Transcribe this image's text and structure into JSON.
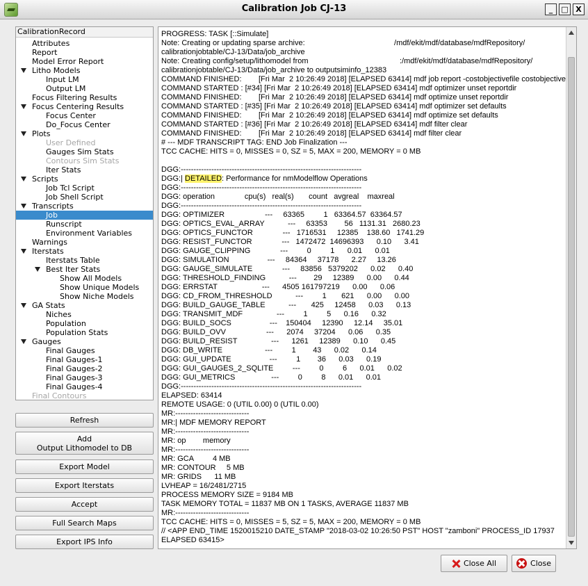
{
  "window": {
    "title": "Calibration Job CJ-13",
    "minimize": "_",
    "maximize": "□",
    "close": "X"
  },
  "tree": {
    "header": "CalibrationRecord",
    "nodes": [
      {
        "label": "Attributes",
        "indent": 1,
        "state": "leaf"
      },
      {
        "label": "Report",
        "indent": 1,
        "state": "leaf"
      },
      {
        "label": "Model Error Report",
        "indent": 1,
        "state": "leaf"
      },
      {
        "label": "Litho Models",
        "indent": 1,
        "state": "expanded"
      },
      {
        "label": "Input LM",
        "indent": 2,
        "state": "leaf"
      },
      {
        "label": "Output LM",
        "indent": 2,
        "state": "leaf"
      },
      {
        "label": "Focus Filtering Results",
        "indent": 1,
        "state": "leaf"
      },
      {
        "label": "Focus Centering Results",
        "indent": 1,
        "state": "expanded"
      },
      {
        "label": "Focus Center",
        "indent": 2,
        "state": "leaf"
      },
      {
        "label": "Do_Focus Center",
        "indent": 2,
        "state": "leaf"
      },
      {
        "label": "Plots",
        "indent": 1,
        "state": "expanded"
      },
      {
        "label": "User Defined",
        "indent": 2,
        "state": "leaf",
        "disabled": true
      },
      {
        "label": "Gauges Sim Stats",
        "indent": 2,
        "state": "leaf"
      },
      {
        "label": "Contours Sim Stats",
        "indent": 2,
        "state": "leaf",
        "disabled": true
      },
      {
        "label": "Iter Stats",
        "indent": 2,
        "state": "leaf"
      },
      {
        "label": "Scripts",
        "indent": 1,
        "state": "expanded"
      },
      {
        "label": "Job Tcl Script",
        "indent": 2,
        "state": "leaf"
      },
      {
        "label": "Job Shell Script",
        "indent": 2,
        "state": "leaf"
      },
      {
        "label": "Transcripts",
        "indent": 1,
        "state": "expanded"
      },
      {
        "label": "Job",
        "indent": 2,
        "state": "leaf",
        "selected": true
      },
      {
        "label": "Runscript",
        "indent": 2,
        "state": "leaf"
      },
      {
        "label": "Environment Variables",
        "indent": 2,
        "state": "leaf"
      },
      {
        "label": "Warnings",
        "indent": 1,
        "state": "leaf"
      },
      {
        "label": "Iterstats",
        "indent": 1,
        "state": "expanded"
      },
      {
        "label": "Iterstats Table",
        "indent": 2,
        "state": "leaf"
      },
      {
        "label": "Best Iter Stats",
        "indent": 2,
        "state": "expanded"
      },
      {
        "label": "Show All Models",
        "indent": 3,
        "state": "leaf"
      },
      {
        "label": "Show Unique Models",
        "indent": 3,
        "state": "leaf"
      },
      {
        "label": "Show Niche Models",
        "indent": 3,
        "state": "leaf"
      },
      {
        "label": "GA Stats",
        "indent": 1,
        "state": "expanded"
      },
      {
        "label": "Niches",
        "indent": 2,
        "state": "leaf"
      },
      {
        "label": "Population",
        "indent": 2,
        "state": "leaf"
      },
      {
        "label": "Population Stats",
        "indent": 2,
        "state": "leaf"
      },
      {
        "label": "Gauges",
        "indent": 1,
        "state": "expanded"
      },
      {
        "label": "Final Gauges",
        "indent": 2,
        "state": "leaf"
      },
      {
        "label": "Final Gauges-1",
        "indent": 2,
        "state": "leaf"
      },
      {
        "label": "Final Gauges-2",
        "indent": 2,
        "state": "leaf"
      },
      {
        "label": "Final Gauges-3",
        "indent": 2,
        "state": "leaf"
      },
      {
        "label": "Final Gauges-4",
        "indent": 2,
        "state": "leaf"
      },
      {
        "label": "Final Contours",
        "indent": 1,
        "state": "leaf",
        "disabled": true
      }
    ]
  },
  "buttons": {
    "refresh": "Refresh",
    "add_line1": "Add",
    "add_line2": "Output Lithomodel to DB",
    "export_model": "Export Model",
    "export_iterstats": "Export Iterstats",
    "accept": "Accept",
    "full_search_maps": "Full Search Maps",
    "export_ips_info": "Export IPS Info",
    "close_all": "Close All",
    "close": "Close"
  },
  "log": {
    "lines": [
      "PROGRESS: TASK [::Simulate]",
      "Note: Creating or updating sparse archive:                                          /mdf/ekit/mdf/database/mdfRepository/",
      "calibrationjobtable/CJ-13/Data/job_archive",
      "Note: Creating config/setup/lithomodel from                                           :/mdf/ekit/mdf/database/mdfRepository/",
      "calibrationjobtable/CJ-13/Data/job_archive to outputsiminfo_12383",
      "COMMAND FINISHED:        [Fri Mar  2 10:26:49 2018] [ELAPSED 63414] mdf job report -costobjectivefile costobjective",
      "COMMAND STARTED : [#34] [Fri Mar  2 10:26:49 2018] [ELAPSED 63414] mdf optimizer unset reportdir",
      "COMMAND FINISHED:        [Fri Mar  2 10:26:49 2018] [ELAPSED 63414] mdf optimize unset reportdir",
      "COMMAND STARTED : [#35] [Fri Mar  2 10:26:49 2018] [ELAPSED 63414] mdf optimizer set defaults",
      "COMMAND FINISHED:        [Fri Mar  2 10:26:49 2018] [ELAPSED 63414] mdf optimize set defaults",
      "COMMAND STARTED : [#36] [Fri Mar  2 10:26:49 2018] [ELAPSED 63414] mdf filter clear",
      "COMMAND FINISHED:        [Fri Mar  2 10:26:49 2018] [ELAPSED 63414] mdf filter clear",
      "# --- MDF TRANSCRIPT TAG: END Job Finalization ---",
      "TCC CACHE: HITS = 0, MISSES = 0, SZ = 5, MAX = 200, MEMORY = 0 MB",
      "",
      "DGG:-----------------------------------------------------------------------",
      "DGG:| DETAILED: Performance for nmModelflow Operations",
      "DGG:-----------------------------------------------------------------------",
      "DGG: operation              cpu(s)   real(s)       count   avgreal    maxreal",
      "DGG:-----------------------------------------------------------------------",
      "DGG: OPTIMIZER                   ---     63365         1   63364.57  63364.57",
      "DGG: OPTICS_EVAL_ARRAY           ---     63353        56   1131.31   2680.23",
      "DGG: OPTICS_FUNCTOR              ---   1716531     12385    138.60   1741.29",
      "DGG: RESIST_FUNCTOR              ---   1472472  14696393      0.10      3.41",
      "DGG: GAUGE_CLIPPING              ---         0         1      0.01      0.01",
      "DGG: SIMULATION                  ---     84364     37178      2.27     13.26",
      "DGG: GAUGE_SIMULATE              ---     83856   5379202      0.02      0.40",
      "DGG: THRESHOLD_FINDING           ---        29     12389      0.00      0.44",
      "DGG: ERRSTAT                     ---      4505 161797219      0.00      0.06",
      "DGG: CD_FROM_THRESHOLD           ---         1       621      0.00      0.00",
      "DGG: BUILD_GAUGE_TABLE           ---       425     12458      0.03      0.13",
      "DGG: TRANSMIT_MDF                ---         1         5      0.16      0.32",
      "DGG: BUILD_SOCS                  ---    150404     12390     12.14     35.01",
      "DGG: BUILD_OVV                   ---      2074     37204      0.06      0.35",
      "DGG: BUILD_RESIST                ---      1261     12389      0.10      0.45",
      "DGG: DB_WRITE                    ---         1        43      0.02      0.14",
      "DGG: GUI_UPDATE                  ---         1        36      0.03      0.19",
      "DGG: GUI_GAUGES_2_SQLITE         ---         0         6      0.01      0.02",
      "DGG: GUI_METRICS                 ---         0         8      0.01      0.01",
      "DGG:-----------------------------------------------------------------------",
      "ELAPSED: 63414",
      "REMOTE USAGE: 0 (UTIL 0.00) 0 (UTIL 0.00)",
      "MR:-----------------------------",
      "MR:| MDF MEMORY REPORT",
      "MR:-----------------------------",
      "MR: op        memory",
      "MR:-----------------------------",
      "MR: GCA         4 MB",
      "MR: CONTOUR     5 MB",
      "MR: GRIDS      11 MB",
      "LVHEAP = 16/2481/2715",
      "PROCESS MEMORY SIZE = 9184 MB",
      "TASK MEMORY TOTAL = 11837 MB ON 1 TASKS, AVERAGE 11837 MB",
      "MR:-----------------------------",
      "TCC CACHE: HITS = 0, MISSES = 5, SZ = 5, MAX = 200, MEMORY = 0 MB",
      "// <APP END_TIME 1520015210 DATE_STAMP \"2018-03-02 10:26:50 PST\" HOST \"zamboni\" PROCESS_ID 17937",
      "ELAPSED 63415>"
    ],
    "highlight_word": "DETAILED",
    "scroll_position": 0.98
  },
  "colors": {
    "selection": "#3a8bcc",
    "highlight": "#fff36b",
    "close_icon": "#c81212"
  }
}
